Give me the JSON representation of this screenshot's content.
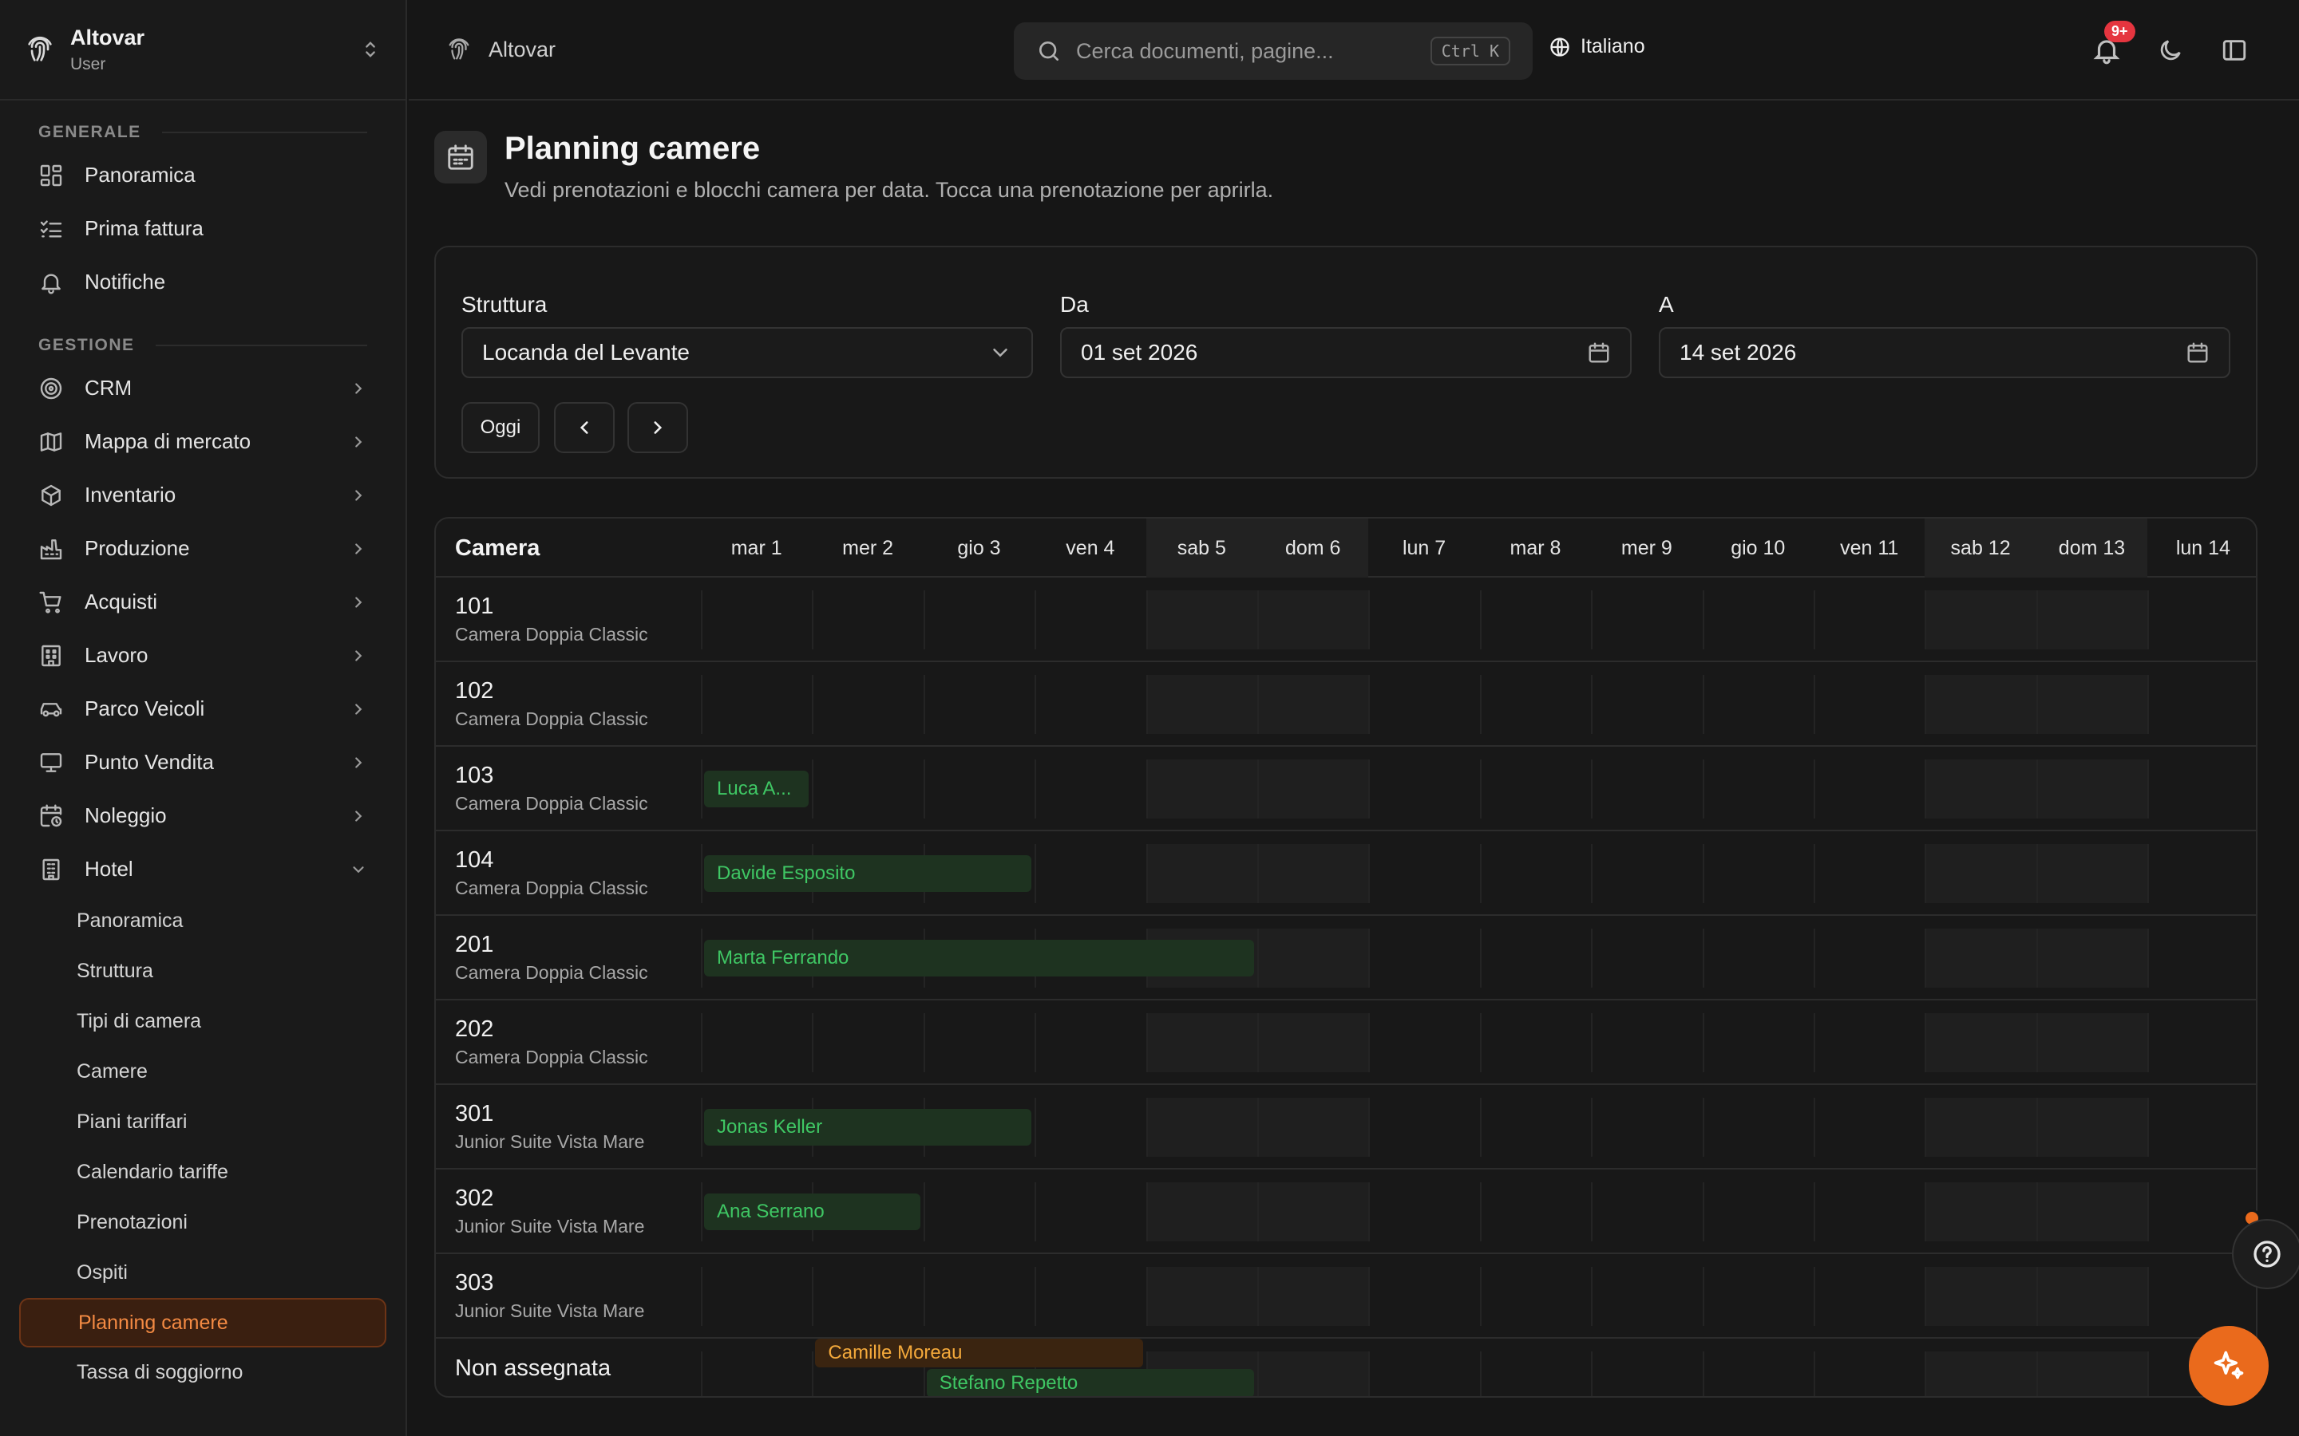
{
  "brand": {
    "name": "Altovar",
    "role": "User"
  },
  "sidebar": {
    "sections": [
      "GENERALE",
      "GESTIONE"
    ],
    "generale": [
      {
        "label": "Panoramica",
        "icon": "dashboard-icon"
      },
      {
        "label": "Prima fattura",
        "icon": "checklist-icon"
      },
      {
        "label": "Notifiche",
        "icon": "bell-icon"
      }
    ],
    "gestione": [
      {
        "label": "CRM",
        "icon": "target-icon"
      },
      {
        "label": "Mappa di mercato",
        "icon": "map-icon"
      },
      {
        "label": "Inventario",
        "icon": "box-icon"
      },
      {
        "label": "Produzione",
        "icon": "factory-icon"
      },
      {
        "label": "Acquisti",
        "icon": "cart-icon"
      },
      {
        "label": "Lavoro",
        "icon": "work-icon"
      },
      {
        "label": "Parco Veicoli",
        "icon": "car-icon"
      },
      {
        "label": "Punto Vendita",
        "icon": "monitor-icon"
      },
      {
        "label": "Noleggio",
        "icon": "calendar-clock-icon"
      },
      {
        "label": "Hotel",
        "icon": "building-icon"
      }
    ],
    "hotel_sub": [
      "Panoramica",
      "Struttura",
      "Tipi di camera",
      "Camere",
      "Piani tariffari",
      "Calendario tariffe",
      "Prenotazioni",
      "Ospiti",
      "Planning camere",
      "Tassa di soggiorno"
    ],
    "active_sub": "Planning camere"
  },
  "topbar": {
    "crumb": "Altovar",
    "search_placeholder": "Cerca documenti, pagine...",
    "shortcut": "Ctrl K",
    "language": "Italiano",
    "notif_badge": "9+"
  },
  "page": {
    "title": "Planning camere",
    "subtitle": "Vedi prenotazioni e blocchi camera per data. Tocca una prenotazione per aprirla."
  },
  "filters": {
    "struttura_label": "Struttura",
    "struttura_value": "Locanda del Levante",
    "da_label": "Da",
    "da_value": "01 set 2026",
    "a_label": "A",
    "a_value": "14 set 2026",
    "today_label": "Oggi"
  },
  "grid": {
    "header": "Camera",
    "days": [
      {
        "label": "mar 1",
        "weekend": false
      },
      {
        "label": "mer 2",
        "weekend": false
      },
      {
        "label": "gio 3",
        "weekend": false
      },
      {
        "label": "ven 4",
        "weekend": false
      },
      {
        "label": "sab 5",
        "weekend": true
      },
      {
        "label": "dom 6",
        "weekend": true
      },
      {
        "label": "lun 7",
        "weekend": false
      },
      {
        "label": "mar 8",
        "weekend": false
      },
      {
        "label": "mer 9",
        "weekend": false
      },
      {
        "label": "gio 10",
        "weekend": false
      },
      {
        "label": "ven 11",
        "weekend": false
      },
      {
        "label": "sab 12",
        "weekend": true
      },
      {
        "label": "dom 13",
        "weekend": true
      },
      {
        "label": "lun 14",
        "weekend": false
      }
    ],
    "rooms": [
      {
        "number": "101",
        "type": "Camera Doppia Classic",
        "bookings": []
      },
      {
        "number": "102",
        "type": "Camera Doppia Classic",
        "bookings": []
      },
      {
        "number": "103",
        "type": "Camera Doppia Classic",
        "bookings": [
          {
            "guest": "Luca A...",
            "start": 0,
            "nights": 1,
            "status": "confirmed"
          }
        ]
      },
      {
        "number": "104",
        "type": "Camera Doppia Classic",
        "bookings": [
          {
            "guest": "Davide Esposito",
            "start": 0,
            "nights": 3,
            "status": "confirmed"
          }
        ]
      },
      {
        "number": "201",
        "type": "Camera Doppia Classic",
        "bookings": [
          {
            "guest": "Marta Ferrando",
            "start": 0,
            "nights": 5,
            "status": "confirmed"
          }
        ]
      },
      {
        "number": "202",
        "type": "Camera Doppia Classic",
        "bookings": []
      },
      {
        "number": "301",
        "type": "Junior Suite Vista Mare",
        "bookings": [
          {
            "guest": "Jonas Keller",
            "start": 0,
            "nights": 3,
            "status": "confirmed"
          }
        ]
      },
      {
        "number": "302",
        "type": "Junior Suite Vista Mare",
        "bookings": [
          {
            "guest": "Ana Serrano",
            "start": 0,
            "nights": 2,
            "status": "confirmed"
          }
        ]
      },
      {
        "number": "303",
        "type": "Junior Suite Vista Mare",
        "bookings": []
      }
    ],
    "unassigned_label": "Non assegnata",
    "unassigned": [
      {
        "guest": "Camille Moreau",
        "start": 1,
        "nights": 3,
        "status": "pending"
      },
      {
        "guest": "Stefano Repetto",
        "start": 2,
        "nights": 3,
        "status": "confirmed"
      }
    ]
  },
  "colors": {
    "accent": "#ea6a1c",
    "confirmed": "#3fc764",
    "pending": "#f4a93b"
  }
}
